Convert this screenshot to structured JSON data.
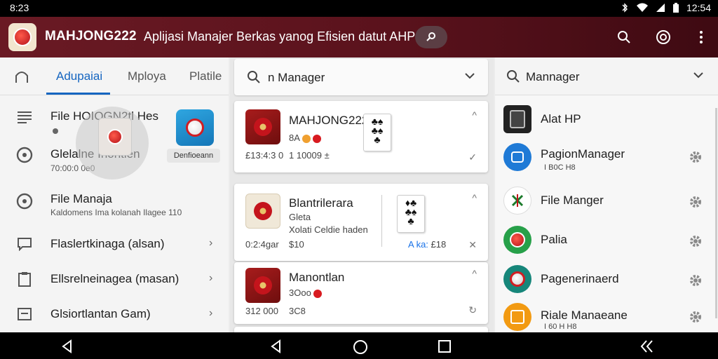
{
  "status_bar": {
    "time": "8:23",
    "clock_right": "12:54"
  },
  "app_bar": {
    "title": "MAHJONG222",
    "subtitle": "Aplijasi Manajer Berkas yanog Efisien datut AHP",
    "icons": [
      "search-icon",
      "at-icon",
      "more-vert-icon"
    ]
  },
  "left_panel": {
    "tabs": [
      {
        "label": "Adupaiai",
        "active": true
      },
      {
        "label": "Mploya",
        "active": false
      },
      {
        "label": "Platile",
        "active": false
      }
    ],
    "items": [
      {
        "title": "File HOIOGN2tl Hes",
        "sub": ""
      },
      {
        "title": "Glelalne Inontlen",
        "sub": "70:00:0 0e0"
      },
      {
        "title": "File Manaja",
        "sub": "Kaldomens Ima kolanah Ilagee 110"
      },
      {
        "title": "Flaslertkinaga (alsan)",
        "sub": ""
      },
      {
        "title": "Ellsrelneinagea (masan)",
        "sub": ""
      },
      {
        "title": "Glsiortlantan Gam)",
        "sub": ""
      }
    ],
    "folder_label": "Denfioeann"
  },
  "middle_panel": {
    "search_text": "n Manager",
    "cards": [
      {
        "name": "MAHJONG222",
        "badge": "8A",
        "meta": "£13:4:3 0",
        "meta2": "1 10009 ±"
      },
      {
        "name": "Blantrilerara",
        "sub": "Gleta",
        "sub2": "Xolati Celdie haden",
        "meta": "0:2:4gar",
        "meta2": "$10",
        "tag": "A ka: ",
        "tag2": "£18"
      },
      {
        "name": "Manontlan",
        "sub": "3Ooo",
        "meta": "312 000",
        "meta2": "3C8"
      }
    ]
  },
  "right_panel": {
    "search_text": "Mannager",
    "items": [
      {
        "name": "Alat HP",
        "sub": "",
        "icon_color": "#222222",
        "gear": false
      },
      {
        "name": "PagionManager",
        "sub": "I B0C H8",
        "icon_color": "#1f7ad6",
        "gear": true
      },
      {
        "name": "File Manger",
        "sub": "",
        "icon_color": "#ffffff",
        "gear": true
      },
      {
        "name": "Palia",
        "sub": "",
        "icon_color": "#27a049",
        "gear": true
      },
      {
        "name": "Pagenerinaerd",
        "sub": "",
        "icon_color": "#16867a",
        "gear": true
      },
      {
        "name": "Riale Manaeane",
        "sub": "I 60 H H8",
        "icon_color": "#f29a12",
        "gear": true
      }
    ]
  },
  "colors": {
    "accent": "#1565c0",
    "app_bar": "#6a1a24",
    "red": "#c4141c"
  }
}
